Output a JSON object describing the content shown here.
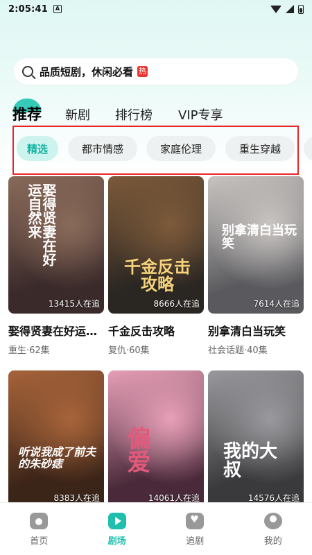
{
  "status": {
    "time": "2:05:41",
    "notif_letter": "A"
  },
  "search": {
    "text": "品质短剧，休闲必看",
    "badge": "热"
  },
  "tabs": [
    {
      "label": "推荐",
      "active": true
    },
    {
      "label": "新剧",
      "active": false
    },
    {
      "label": "排行榜",
      "active": false
    },
    {
      "label": "VIP专享",
      "active": false
    }
  ],
  "chips": [
    {
      "label": "精选",
      "active": true
    },
    {
      "label": "都市情感",
      "active": false
    },
    {
      "label": "家庭伦理",
      "active": false
    },
    {
      "label": "重生穿越",
      "active": false
    }
  ],
  "dramas": [
    {
      "title": "娶得贤妻在好运…",
      "meta": "重生·62集",
      "followers": "13415人在追",
      "poster_text": "娶得贤妻在好运自然来",
      "colors": [
        "#3a2a2a",
        "#8a6b5a"
      ]
    },
    {
      "title": "千金反击攻略",
      "meta": "复仇·60集",
      "followers": "8666人在追",
      "poster_text": "千金反击攻略",
      "colors": [
        "#2a2622",
        "#7d5a3a"
      ]
    },
    {
      "title": "别拿清白当玩笑",
      "meta": "社会话题·40集",
      "followers": "7614人在追",
      "poster_text": "别拿清白当玩笑",
      "colors": [
        "#5a5a5e",
        "#c9c5c2"
      ]
    },
    {
      "title": "",
      "meta": "",
      "followers": "8383人在追",
      "poster_text": "听说我成了前夫的朱砂痣",
      "colors": [
        "#3b2418",
        "#a8643a"
      ]
    },
    {
      "title": "",
      "meta": "",
      "followers": "14061人在追",
      "poster_text": "偏爱",
      "colors": [
        "#4a2a3a",
        "#e8a0b8"
      ]
    },
    {
      "title": "",
      "meta": "",
      "followers": "14576人在追",
      "poster_text": "我的大叔",
      "colors": [
        "#3a3a3c",
        "#9a9a9e"
      ]
    }
  ],
  "nav": [
    {
      "label": "首页",
      "icon": "home-icon",
      "active": false
    },
    {
      "label": "剧场",
      "icon": "theater-icon",
      "active": true
    },
    {
      "label": "追剧",
      "icon": "follow-icon",
      "active": false
    },
    {
      "label": "我的",
      "icon": "mine-icon",
      "active": false
    }
  ],
  "colors": {
    "accent": "#1fbfae",
    "highlight_box": "#e8262a",
    "hot_badge": "#e8352f"
  }
}
